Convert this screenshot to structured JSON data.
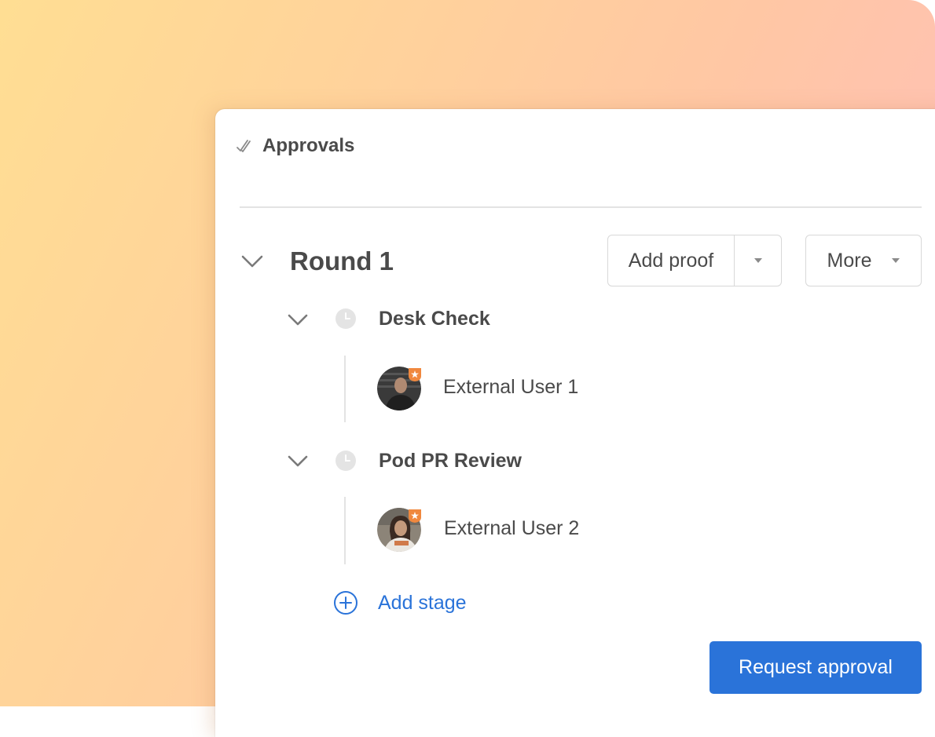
{
  "header": {
    "title": "Approvals",
    "icon": "double-check-icon"
  },
  "round": {
    "title": "Round 1",
    "add_proof_label": "Add proof",
    "more_label": "More"
  },
  "stages": [
    {
      "title": "Desk Check",
      "status_icon": "clock-icon",
      "reviewers": [
        {
          "name": "External User 1",
          "badge": "star-badge"
        }
      ]
    },
    {
      "title": "Pod PR Review",
      "status_icon": "clock-icon",
      "reviewers": [
        {
          "name": "External User 2",
          "badge": "star-badge"
        }
      ]
    }
  ],
  "add_stage_label": "Add stage",
  "request_approval_label": "Request approval",
  "colors": {
    "accent": "#2a73d9",
    "badge": "#f0883e",
    "text": "#4a4a4a",
    "border": "#d8d8d8"
  }
}
